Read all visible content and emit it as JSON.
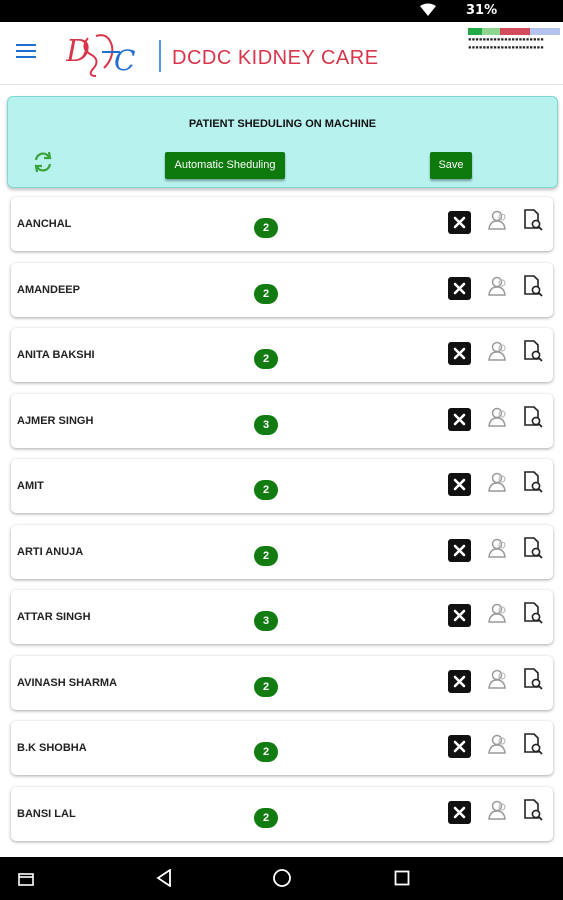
{
  "status_bar": {
    "battery": "31%",
    "wifi_icon": "wifi-icon"
  },
  "header": {
    "logo_text": "DCDC",
    "brand_name": "DCDC KIDNEY CARE",
    "menu_icon": "hamburger-menu-icon",
    "accent_color": "#1f6fd1",
    "brand_color": "#d8344a"
  },
  "panel": {
    "title": "PATIENT SHEDULING ON MACHINE",
    "auto_button": "Automatic Sheduling",
    "save_button": "Save",
    "refresh_icon": "refresh-icon",
    "background": "#b8f2ee",
    "button_color": "#0e7a0e"
  },
  "patients": [
    {
      "name": "AANCHAL",
      "count": "2"
    },
    {
      "name": "AMANDEEP",
      "count": "2"
    },
    {
      "name": "ANITA BAKSHI",
      "count": "2"
    },
    {
      "name": "AJMER SINGH",
      "count": "3"
    },
    {
      "name": "AMIT",
      "count": "2"
    },
    {
      "name": "ARTI ANUJA",
      "count": "2"
    },
    {
      "name": "ATTAR SINGH",
      "count": "3"
    },
    {
      "name": "AVINASH SHARMA",
      "count": "2"
    },
    {
      "name": "B.K SHOBHA",
      "count": "2"
    },
    {
      "name": "BANSI LAL",
      "count": "2"
    }
  ],
  "row_icons": [
    "close-icon",
    "user-icon",
    "document-search-icon"
  ],
  "nav_bar": [
    "recent-apps-icon",
    "back-icon",
    "home-icon",
    "overview-icon"
  ]
}
